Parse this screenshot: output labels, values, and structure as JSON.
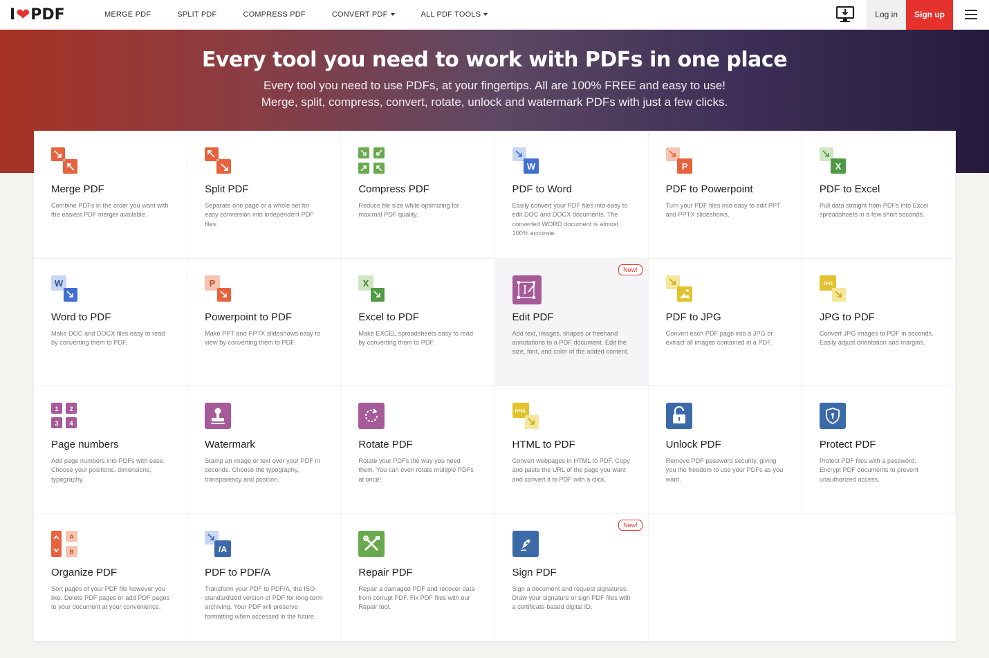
{
  "nav": {
    "logo_pre": "I",
    "logo_post": "PDF",
    "items": [
      {
        "label": "MERGE PDF",
        "dropdown": false
      },
      {
        "label": "SPLIT PDF",
        "dropdown": false
      },
      {
        "label": "COMPRESS PDF",
        "dropdown": false
      },
      {
        "label": "CONVERT PDF",
        "dropdown": true
      },
      {
        "label": "ALL PDF TOOLS",
        "dropdown": true
      }
    ],
    "login": "Log in",
    "signup": "Sign up"
  },
  "hero": {
    "title": "Every tool you need to work with PDFs in one place",
    "subtitle": "Every tool you need to use PDFs, at your fingertips. All are 100% FREE and easy to use! Merge, split, compress, convert, rotate, unlock and watermark PDFs with just a few clicks."
  },
  "colors": {
    "brand_red": "#e5322d",
    "orange": "#e8623e",
    "green": "#6aaa4f",
    "blue": "#3f6fd0",
    "purple": "#a65a98",
    "yellow": "#e2c32d",
    "dark_blue": "#3c6aa8"
  },
  "tools": [
    {
      "title": "Merge PDF",
      "desc": "Combine PDFs in the order you want with the easiest PDF merger available.",
      "icon": "merge-icon",
      "new": false
    },
    {
      "title": "Split PDF",
      "desc": "Separate one page or a whole set for easy conversion into independent PDF files.",
      "icon": "split-icon",
      "new": false
    },
    {
      "title": "Compress PDF",
      "desc": "Reduce file size while optimizing for maximal PDF quality.",
      "icon": "compress-icon",
      "new": false
    },
    {
      "title": "PDF to Word",
      "desc": "Easily convert your PDF files into easy to edit DOC and DOCX documents. The converted WORD document is almost 100% accurate.",
      "icon": "pdf-to-word-icon",
      "new": false
    },
    {
      "title": "PDF to Powerpoint",
      "desc": "Turn your PDF files into easy to edit PPT and PPTX slideshows.",
      "icon": "pdf-to-powerpoint-icon",
      "new": false
    },
    {
      "title": "PDF to Excel",
      "desc": "Pull data straight from PDFs into Excel spreadsheets in a few short seconds.",
      "icon": "pdf-to-excel-icon",
      "new": false
    },
    {
      "title": "Word to PDF",
      "desc": "Make DOC and DOCX files easy to read by converting them to PDF.",
      "icon": "word-to-pdf-icon",
      "new": false
    },
    {
      "title": "Powerpoint to PDF",
      "desc": "Make PPT and PPTX slideshows easy to view by converting them to PDF.",
      "icon": "powerpoint-to-pdf-icon",
      "new": false
    },
    {
      "title": "Excel to PDF",
      "desc": "Make EXCEL spreadsheets easy to read by converting them to PDF.",
      "icon": "excel-to-pdf-icon",
      "new": false
    },
    {
      "title": "Edit PDF",
      "desc": "Add text, images, shapes or freehand annotations to a PDF document. Edit the size, font, and color of the added content.",
      "icon": "edit-pdf-icon",
      "new": true
    },
    {
      "title": "PDF to JPG",
      "desc": "Convert each PDF page into a JPG or extract all images contained in a PDF.",
      "icon": "pdf-to-jpg-icon",
      "new": false
    },
    {
      "title": "JPG to PDF",
      "desc": "Convert JPG images to PDF in seconds. Easily adjust orientation and margins.",
      "icon": "jpg-to-pdf-icon",
      "new": false
    },
    {
      "title": "Page numbers",
      "desc": "Add page numbers into PDFs with ease. Choose your positions, dimensions, typography.",
      "icon": "page-numbers-icon",
      "new": false
    },
    {
      "title": "Watermark",
      "desc": "Stamp an image or text over your PDF in seconds. Choose the typography, transparency and position.",
      "icon": "watermark-icon",
      "new": false
    },
    {
      "title": "Rotate PDF",
      "desc": "Rotate your PDFs the way you need them. You can even rotate multiple PDFs at once!",
      "icon": "rotate-icon",
      "new": false
    },
    {
      "title": "HTML to PDF",
      "desc": "Convert webpages in HTML to PDF. Copy and paste the URL of the page you want and convert it to PDF with a click.",
      "icon": "html-to-pdf-icon",
      "new": false
    },
    {
      "title": "Unlock PDF",
      "desc": "Remove PDF password security, giving you the freedom to use your PDFs as you want.",
      "icon": "unlock-icon",
      "new": false
    },
    {
      "title": "Protect PDF",
      "desc": "Protect PDF files with a password. Encrypt PDF documents to prevent unauthorized access.",
      "icon": "protect-icon",
      "new": false
    },
    {
      "title": "Organize PDF",
      "desc": "Sort pages of your PDF file however you like. Delete PDF pages or add PDF pages to your document at your convenience.",
      "icon": "organize-icon",
      "new": false
    },
    {
      "title": "PDF to PDF/A",
      "desc": "Transform your PDF to PDF/A, the ISO-standardized version of PDF for long-term archiving. Your PDF will preserve formatting when accessed in the future.",
      "icon": "pdf-to-pdfa-icon",
      "new": false
    },
    {
      "title": "Repair PDF",
      "desc": "Repair a damaged PDF and recover data from corrupt PDF. Fix PDF files with our Repair tool.",
      "icon": "repair-icon",
      "new": false
    },
    {
      "title": "Sign PDF",
      "desc": "Sign a document and request signatures. Draw your signature or sign PDF files with a certificate-based digital ID.",
      "icon": "sign-icon",
      "new": true
    }
  ],
  "new_badge": "New!",
  "icon_text": {
    "word": "W",
    "ppt": "P",
    "excel": "X",
    "jpg": "JPG",
    "html": "HTML",
    "pdfa": "/A",
    "n1": "1",
    "n2": "2",
    "n3": "3",
    "n4": "4",
    "a": "A",
    "b": "B"
  }
}
